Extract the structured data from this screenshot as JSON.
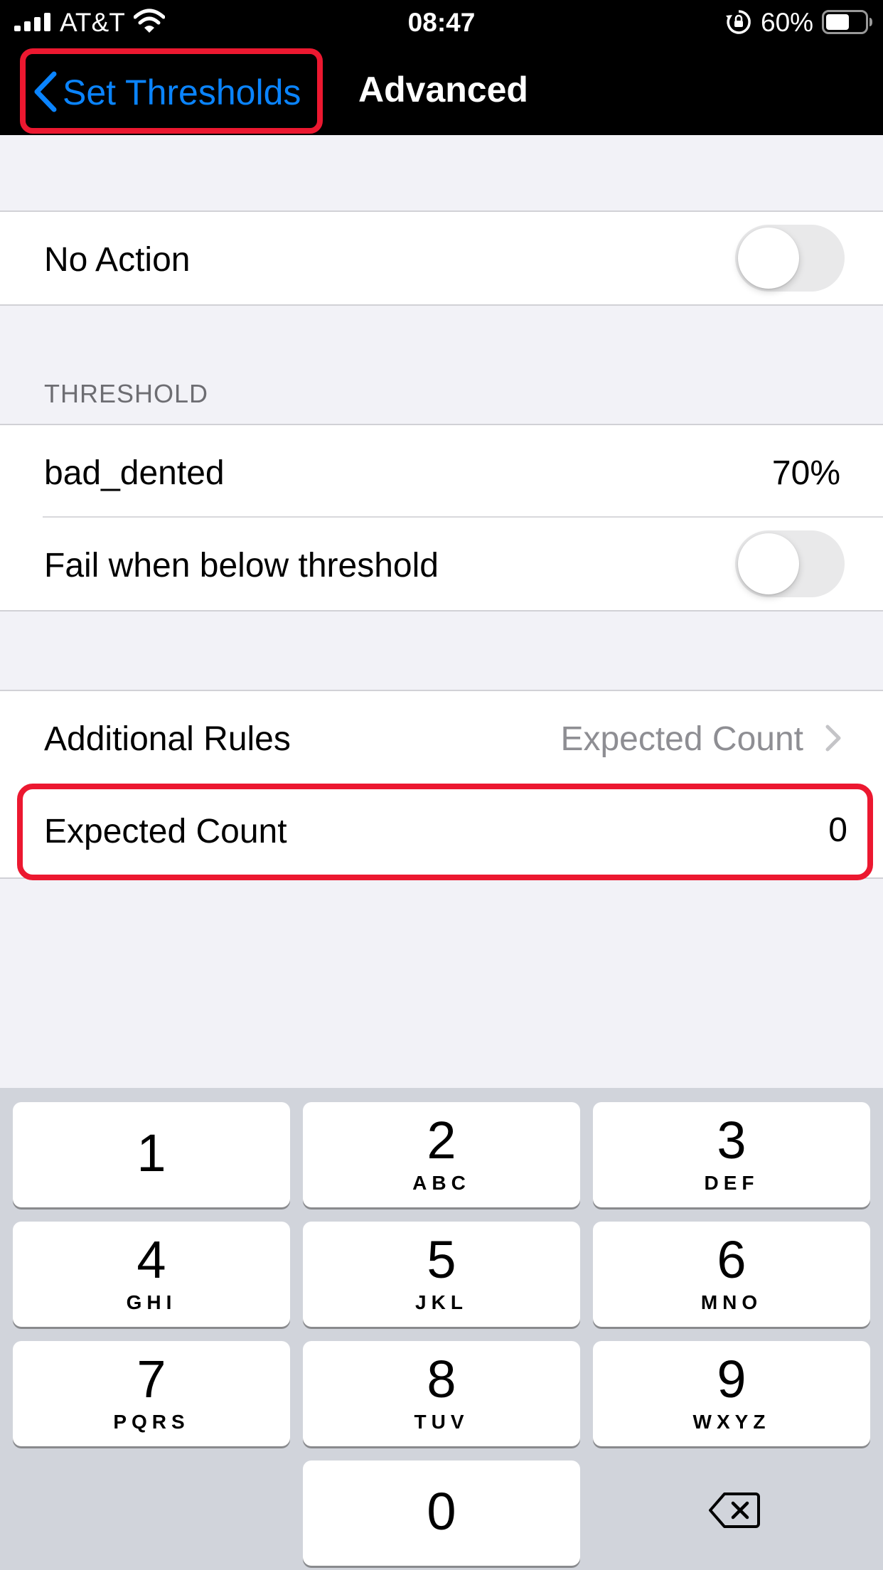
{
  "status_bar": {
    "carrier": "AT&T",
    "time": "08:47",
    "battery_percent": "60%",
    "battery_level": 0.6,
    "icons": [
      "signal-icon",
      "wifi-icon",
      "orientation-lock-icon",
      "battery-icon"
    ]
  },
  "nav": {
    "back_label": "Set Thresholds",
    "title": "Advanced"
  },
  "rows": {
    "no_action": {
      "label": "No Action",
      "toggle_on": false
    },
    "threshold_header": "THRESHOLD",
    "bad_dented": {
      "label": "bad_dented",
      "value": "70%"
    },
    "fail_below": {
      "label": "Fail when below threshold",
      "toggle_on": false
    },
    "additional_rules": {
      "label": "Additional Rules",
      "detail": "Expected Count"
    },
    "expected_count": {
      "label": "Expected Count",
      "value": "0"
    }
  },
  "keyboard": {
    "keys": [
      {
        "digit": "1",
        "letters": ""
      },
      {
        "digit": "2",
        "letters": "ABC"
      },
      {
        "digit": "3",
        "letters": "DEF"
      },
      {
        "digit": "4",
        "letters": "GHI"
      },
      {
        "digit": "5",
        "letters": "JKL"
      },
      {
        "digit": "6",
        "letters": "MNO"
      },
      {
        "digit": "7",
        "letters": "PQRS"
      },
      {
        "digit": "8",
        "letters": "TUV"
      },
      {
        "digit": "9",
        "letters": "WXYZ"
      },
      {
        "digit": "0",
        "letters": ""
      }
    ]
  },
  "colors": {
    "accent": "#0a84ff",
    "highlight": "#ec1830",
    "toggle_off": "#e9e9ea"
  }
}
